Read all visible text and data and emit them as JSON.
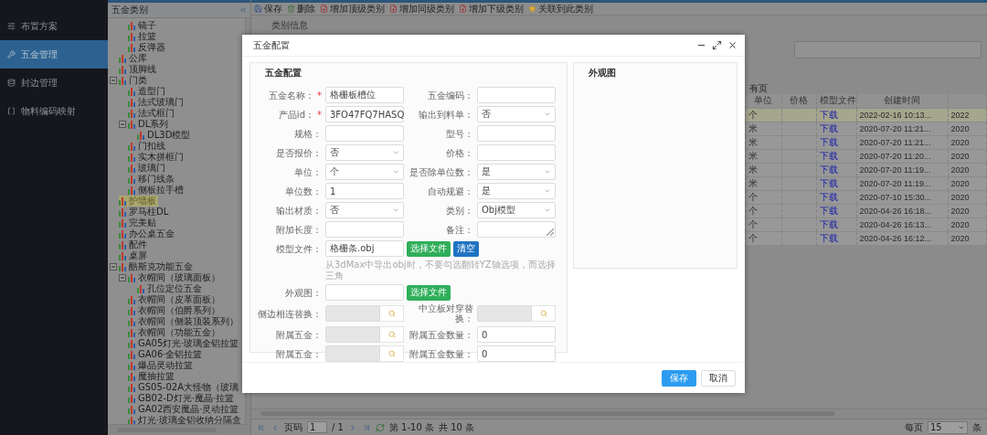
{
  "nav": [
    {
      "label": "布置方案",
      "kind": "layout",
      "selected": false
    },
    {
      "label": "五金管理",
      "kind": "hardware",
      "selected": true
    },
    {
      "label": "封边管理",
      "kind": "edge",
      "selected": false
    },
    {
      "label": "物料编码映射",
      "kind": "mapping",
      "selected": false
    }
  ],
  "tree": {
    "title": "五金类别",
    "continued_children": [
      {
        "label": "镜子",
        "selected": false
      },
      {
        "label": "拉篮",
        "selected": false
      },
      {
        "label": "反弹器",
        "selected": false
      }
    ],
    "items": [
      {
        "label": "公库",
        "selected": false
      },
      {
        "label": "顶脚线",
        "selected": false
      },
      {
        "label": "门类",
        "selected": false,
        "expanded": true,
        "children": [
          {
            "label": "造型门",
            "selected": false
          },
          {
            "label": "法式玻璃门",
            "selected": false
          },
          {
            "label": "法式框门",
            "selected": false
          },
          {
            "label": "DL系列",
            "selected": false,
            "expanded": true,
            "children": [
              {
                "label": "DL3D模型",
                "selected": false
              }
            ]
          },
          {
            "label": "门扣线",
            "selected": false
          },
          {
            "label": "实木拼框门",
            "selected": false
          },
          {
            "label": "玻璃门",
            "selected": false
          },
          {
            "label": "移门线条",
            "selected": false
          },
          {
            "label": "侧板拉手槽",
            "selected": false
          }
        ]
      },
      {
        "label": "护墙板",
        "selected": true
      },
      {
        "label": "罗马柱DL",
        "selected": false
      },
      {
        "label": "完美贴",
        "selected": false
      },
      {
        "label": "办公桌五金",
        "selected": false
      },
      {
        "label": "配件",
        "selected": false
      },
      {
        "label": "桌屏",
        "selected": false
      },
      {
        "label": "酷斯克功能五金",
        "selected": false,
        "expanded": true,
        "children": [
          {
            "label": "衣帽间（玻璃面板）",
            "selected": false,
            "expanded": true,
            "children": [
              {
                "label": "孔位定位五金",
                "selected": false
              }
            ]
          },
          {
            "label": "衣帽间（皮革面板）",
            "selected": false
          },
          {
            "label": "衣帽间（伯爵系列）",
            "selected": false
          },
          {
            "label": "衣帽间（侧装顶装系列）",
            "selected": false
          },
          {
            "label": "衣帽间（功能五金）",
            "selected": false
          },
          {
            "label": "GA05灯光·玻璃全铝拉篮",
            "selected": false
          },
          {
            "label": "GA06·全铝拉篮",
            "selected": false
          },
          {
            "label": "爆品灵动拉篮",
            "selected": false
          },
          {
            "label": "魔抽拉篮",
            "selected": false
          },
          {
            "label": "GS05-02A大怪物（玻璃",
            "selected": false
          },
          {
            "label": "GB02-D灯光·魔晶·拉篮",
            "selected": false
          },
          {
            "label": "GA02西安魔晶·灵动拉篮",
            "selected": false
          },
          {
            "label": "灯光·玻璃全铝收纳分隔盒",
            "selected": false
          }
        ]
      }
    ]
  },
  "toolbar": [
    {
      "label": "保存",
      "kind": "save"
    },
    {
      "label": "删除",
      "kind": "delete"
    },
    {
      "label": "增加顶级类别",
      "kind": "add"
    },
    {
      "label": "增加同级类别",
      "kind": "add"
    },
    {
      "label": "增加下级类别",
      "kind": "add"
    },
    {
      "label": "关联到此类别",
      "kind": "link"
    }
  ],
  "category_info": {
    "legend": "类别信息"
  },
  "grid": {
    "caption": "有页",
    "columns": [
      "单位",
      "价格",
      "模型文件",
      "创建时间"
    ],
    "rows": [
      {
        "unit": "个",
        "model_file": "下载",
        "created": "2022-02-16 10:13...",
        "column_5": "2022",
        "selected": true
      },
      {
        "unit": "米",
        "model_file": "下载",
        "created": "2020-07-20 11:21...",
        "column_5": "2020",
        "selected": false
      },
      {
        "unit": "米",
        "model_file": "下载",
        "created": "2020-07-20 11:21...",
        "column_5": "2020",
        "selected": false
      },
      {
        "unit": "米",
        "model_file": "下载",
        "created": "2020-07-20 11:20...",
        "column_5": "2020",
        "selected": false
      },
      {
        "unit": "米",
        "model_file": "下载",
        "created": "2020-07-20 11:19...",
        "column_5": "2020",
        "selected": false
      },
      {
        "unit": "米",
        "model_file": "下载",
        "created": "2020-07-20 11:19...",
        "column_5": "2020",
        "selected": false
      },
      {
        "unit": "个",
        "model_file": "下载",
        "created": "2020-07-10 15:30...",
        "column_5": "2020",
        "selected": false
      },
      {
        "unit": "个",
        "model_file": "下载",
        "created": "2020-04-26 16:18...",
        "column_5": "2020",
        "selected": false
      },
      {
        "unit": "个",
        "model_file": "下载",
        "created": "2020-04-26 16:13...",
        "column_5": "2020",
        "selected": false
      },
      {
        "unit": "个",
        "model_file": "下载",
        "created": "2020-04-26 16:12...",
        "column_5": "2020",
        "selected": false
      }
    ]
  },
  "pager": {
    "page_label": "页码",
    "page": "1",
    "total_pages": "/ 1",
    "range": "第 1-10 条",
    "total": "共 10 条",
    "per_page_label": "每页",
    "per_page": "15",
    "unit": "条"
  },
  "dialog": {
    "title": "五金配置",
    "form": {
      "legend": "五金配置",
      "rows": [
        {
          "kind": "pair",
          "fields": [
            {
              "label": "五金名称：",
              "mark": "*",
              "kind": "text",
              "value": "格栅板槽位"
            },
            {
              "label": "五金编码：",
              "kind": "text"
            }
          ]
        },
        {
          "kind": "pair",
          "fields": [
            {
              "label": "产品id：",
              "mark": "*",
              "kind": "text",
              "value": "3FO47FQ7HASQ"
            },
            {
              "label": "输出到料单：",
              "kind": "select",
              "value": "否"
            }
          ]
        },
        {
          "kind": "pair",
          "fields": [
            {
              "label": "规格：",
              "kind": "text"
            },
            {
              "label": "型号：",
              "kind": "text"
            }
          ]
        },
        {
          "kind": "pair",
          "fields": [
            {
              "label": "是否报价：",
              "kind": "select",
              "value": "否"
            },
            {
              "label": "价格：",
              "kind": "text"
            }
          ]
        },
        {
          "kind": "pair",
          "fields": [
            {
              "label": "单位：",
              "kind": "select",
              "value": "个"
            },
            {
              "label": "是否除单位数：",
              "kind": "select",
              "value": "是"
            }
          ]
        },
        {
          "kind": "pair",
          "fields": [
            {
              "label": "单位数：",
              "kind": "text",
              "value": "1"
            },
            {
              "label": "自动规避：",
              "kind": "select",
              "value": "是"
            }
          ]
        },
        {
          "kind": "pair",
          "fields": [
            {
              "label": "输出材质：",
              "kind": "select",
              "value": "否"
            },
            {
              "label": "类别：",
              "kind": "select",
              "value": "Obj模型"
            }
          ]
        },
        {
          "kind": "pair",
          "fields": [
            {
              "label": "附加长度：",
              "kind": "text"
            },
            {
              "label": "备注：",
              "kind": "textarea"
            }
          ]
        },
        {
          "kind": "file",
          "label": "模型文件：",
          "value": "格栅条.obj",
          "buttons": [
            {
              "label": "选择文件",
              "kind": "choose"
            },
            {
              "label": "清空",
              "kind": "clear"
            }
          ]
        },
        {
          "kind": "hint",
          "text": "从3dMax中导出obj时，不要勾选翻转YZ轴选项，而选择三角"
        },
        {
          "kind": "file",
          "label": "外观图：",
          "buttons": [
            {
              "label": "选择文件",
              "kind": "choose"
            }
          ]
        },
        {
          "kind": "pair",
          "fields": [
            {
              "label": "侧边相连替换：",
              "kind": "lookup"
            },
            {
              "label": "中立板对穿替换：",
              "kind": "lookup"
            }
          ]
        },
        {
          "kind": "pair",
          "fields": [
            {
              "label": "附属五金：",
              "kind": "lookup"
            },
            {
              "label": "附属五金数量：",
              "kind": "text",
              "value": "0"
            }
          ]
        },
        {
          "kind": "pair",
          "fields": [
            {
              "label": "附属五金：",
              "kind": "lookup"
            },
            {
              "label": "附属五金数量：",
              "kind": "text",
              "value": "0"
            }
          ]
        }
      ]
    },
    "preview": {
      "legend": "外观图"
    },
    "buttons": [
      {
        "label": "保存",
        "kind": "primary"
      },
      {
        "label": "取消",
        "kind": "default"
      }
    ]
  }
}
